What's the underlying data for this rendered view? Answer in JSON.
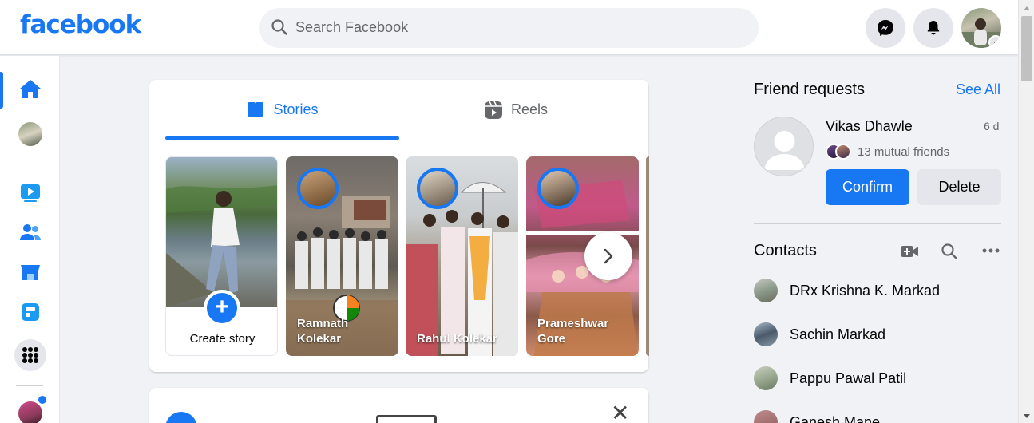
{
  "header": {
    "logo_text": "facebook",
    "search_placeholder": "Search Facebook",
    "brand_color": "#1877f2",
    "icons": [
      "search-icon",
      "messenger-icon",
      "notifications-bell-icon",
      "account-avatar",
      "chevron-down-icon"
    ]
  },
  "left_rail": {
    "items": [
      {
        "name": "home",
        "icon": "home-icon",
        "active": true
      },
      {
        "name": "profile",
        "icon": "avatar"
      },
      {
        "name": "video",
        "icon": "video-icon"
      },
      {
        "name": "friends",
        "icon": "friends-icon"
      },
      {
        "name": "marketplace",
        "icon": "marketplace-icon"
      },
      {
        "name": "feeds",
        "icon": "feeds-icon"
      },
      {
        "name": "menu",
        "icon": "menu-grid-icon"
      },
      {
        "name": "group",
        "icon": "avatar",
        "has_notification_dot": true
      }
    ]
  },
  "stories_card": {
    "tabs": [
      {
        "label": "Stories",
        "active": true,
        "icon": "stories-book-icon"
      },
      {
        "label": "Reels",
        "active": false,
        "icon": "reels-icon"
      }
    ],
    "create_story_label": "Create story",
    "stories": [
      {
        "name": "Ramnath Kolekar"
      },
      {
        "name": "Rahul Kolekar"
      },
      {
        "name": "Prameshwar Gore"
      }
    ],
    "next_icon": "chevron-right-icon"
  },
  "friend_requests": {
    "title": "Friend requests",
    "see_all": "See All",
    "request": {
      "name": "Vikas Dhawle",
      "time": "6 d",
      "mutual": "13 mutual friends",
      "confirm_label": "Confirm",
      "delete_label": "Delete"
    }
  },
  "contacts": {
    "title": "Contacts",
    "icons": [
      "new-room-video-icon",
      "search-icon",
      "more-options-icon"
    ],
    "list": [
      {
        "name": "DRx Krishna K. Markad"
      },
      {
        "name": "Sachin Markad"
      },
      {
        "name": "Pappu Pawal Patil"
      },
      {
        "name": "Ganesh Mane"
      }
    ]
  }
}
